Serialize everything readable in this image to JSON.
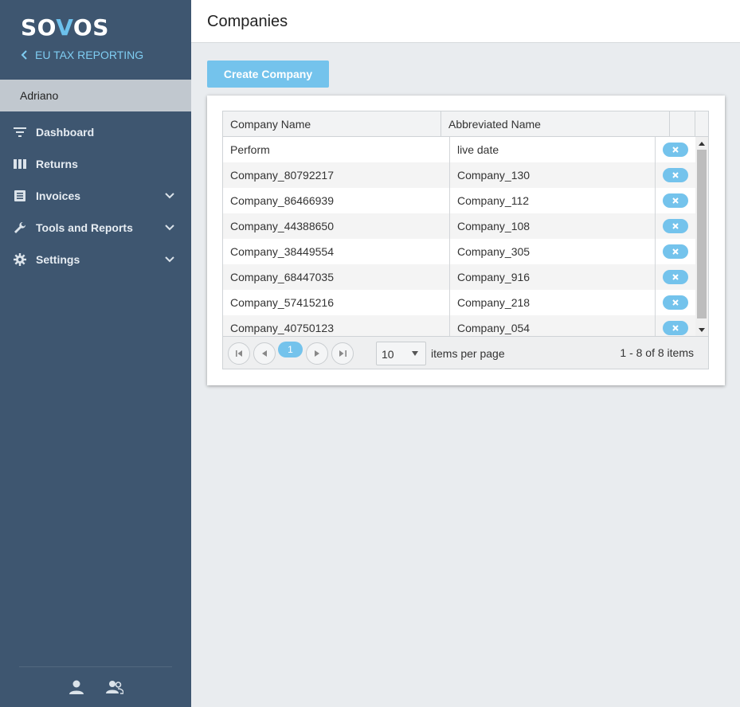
{
  "brand": {
    "logo_prefix": "SO",
    "logo_v": "V",
    "logo_suffix": "OS",
    "accent": "#74c3ec",
    "sidebar_bg": "#3e5670"
  },
  "sidebar": {
    "back_label": "EU TAX REPORTING",
    "user": "Adriano",
    "items": [
      {
        "label": "Dashboard",
        "icon": "filter-icon",
        "expandable": false
      },
      {
        "label": "Returns",
        "icon": "columns-icon",
        "expandable": false
      },
      {
        "label": "Invoices",
        "icon": "document-icon",
        "expandable": true
      },
      {
        "label": "Tools and Reports",
        "icon": "wrench-icon",
        "expandable": true
      },
      {
        "label": "Settings",
        "icon": "gear-icon",
        "expandable": true
      }
    ],
    "footer_icons": [
      "user-icon",
      "users-icon"
    ]
  },
  "header": {
    "title": "Companies"
  },
  "toolbar": {
    "create_label": "Create Company"
  },
  "grid": {
    "columns": [
      "Company Name",
      "Abbreviated Name"
    ],
    "rows": [
      {
        "name": "Perform",
        "abbr": "live date"
      },
      {
        "name": "Company_80792217",
        "abbr": "Company_130"
      },
      {
        "name": "Company_86466939",
        "abbr": "Company_112"
      },
      {
        "name": "Company_44388650",
        "abbr": "Company_108"
      },
      {
        "name": "Company_38449554",
        "abbr": "Company_305"
      },
      {
        "name": "Company_68447035",
        "abbr": "Company_916"
      },
      {
        "name": "Company_57415216",
        "abbr": "Company_218"
      },
      {
        "name": "Company_40750123",
        "abbr": "Company_054"
      }
    ]
  },
  "pager": {
    "current_page": "1",
    "page_size": "10",
    "items_per_page_label": "items per page",
    "info": "1 - 8 of 8 items"
  }
}
